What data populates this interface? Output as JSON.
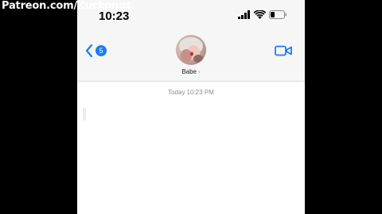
{
  "watermark": "Patreon.com/Kuckonut",
  "status_bar": {
    "time": "10:23",
    "icons": [
      "cellular-signal-icon",
      "wifi-icon",
      "battery-icon"
    ]
  },
  "nav": {
    "back_icon": "chevron-left-icon",
    "unread_count": "5",
    "video_icon": "video-camera-icon"
  },
  "contact": {
    "name": "Babe",
    "chevron": "›"
  },
  "conversation": {
    "timestamp": "Today 10:23 PM"
  },
  "colors": {
    "accent": "#1a7cf6",
    "header_bg": "#f6f6f6",
    "timestamp_text": "#8e8e93"
  }
}
